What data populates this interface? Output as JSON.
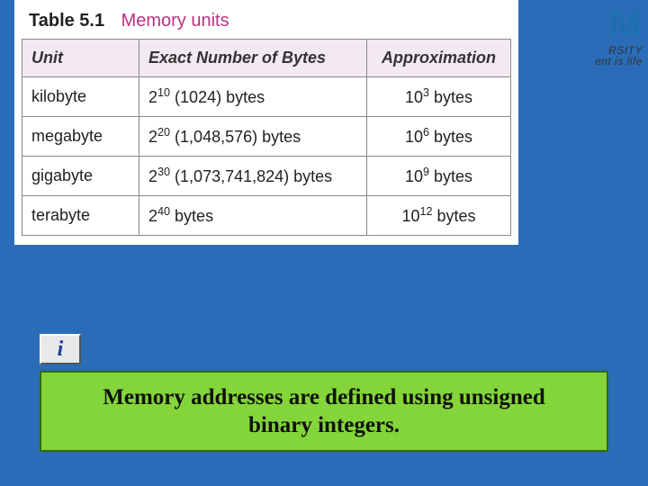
{
  "table": {
    "number_label": "Table 5.1",
    "caption": "Memory units",
    "headers": {
      "unit": "Unit",
      "exact": "Exact Number of Bytes",
      "approx": "Approximation"
    },
    "rows": [
      {
        "unit": "kilobyte",
        "exact_base": "2",
        "exact_exp": "10",
        "exact_paren": "(1024)",
        "exact_suffix": " bytes",
        "approx_base": "10",
        "approx_exp": "3",
        "approx_suffix": " bytes"
      },
      {
        "unit": "megabyte",
        "exact_base": "2",
        "exact_exp": "20",
        "exact_paren": "(1,048,576)",
        "exact_suffix": " bytes",
        "approx_base": "10",
        "approx_exp": "6",
        "approx_suffix": " bytes"
      },
      {
        "unit": "gigabyte",
        "exact_base": "2",
        "exact_exp": "30",
        "exact_paren": "(1,073,741,824)",
        "exact_suffix": " bytes",
        "approx_base": "10",
        "approx_exp": "9",
        "approx_suffix": " bytes"
      },
      {
        "unit": "terabyte",
        "exact_base": "2",
        "exact_exp": "40",
        "exact_paren": "",
        "exact_suffix": " bytes",
        "approx_base": "10",
        "approx_exp": "12",
        "approx_suffix": " bytes"
      }
    ]
  },
  "logo": {
    "big": "M",
    "small1": "RSITY",
    "small2": "ent is life"
  },
  "info_button": {
    "label": "i"
  },
  "note": {
    "line1": "Memory addresses are defined using unsigned",
    "line2": "binary integers."
  }
}
